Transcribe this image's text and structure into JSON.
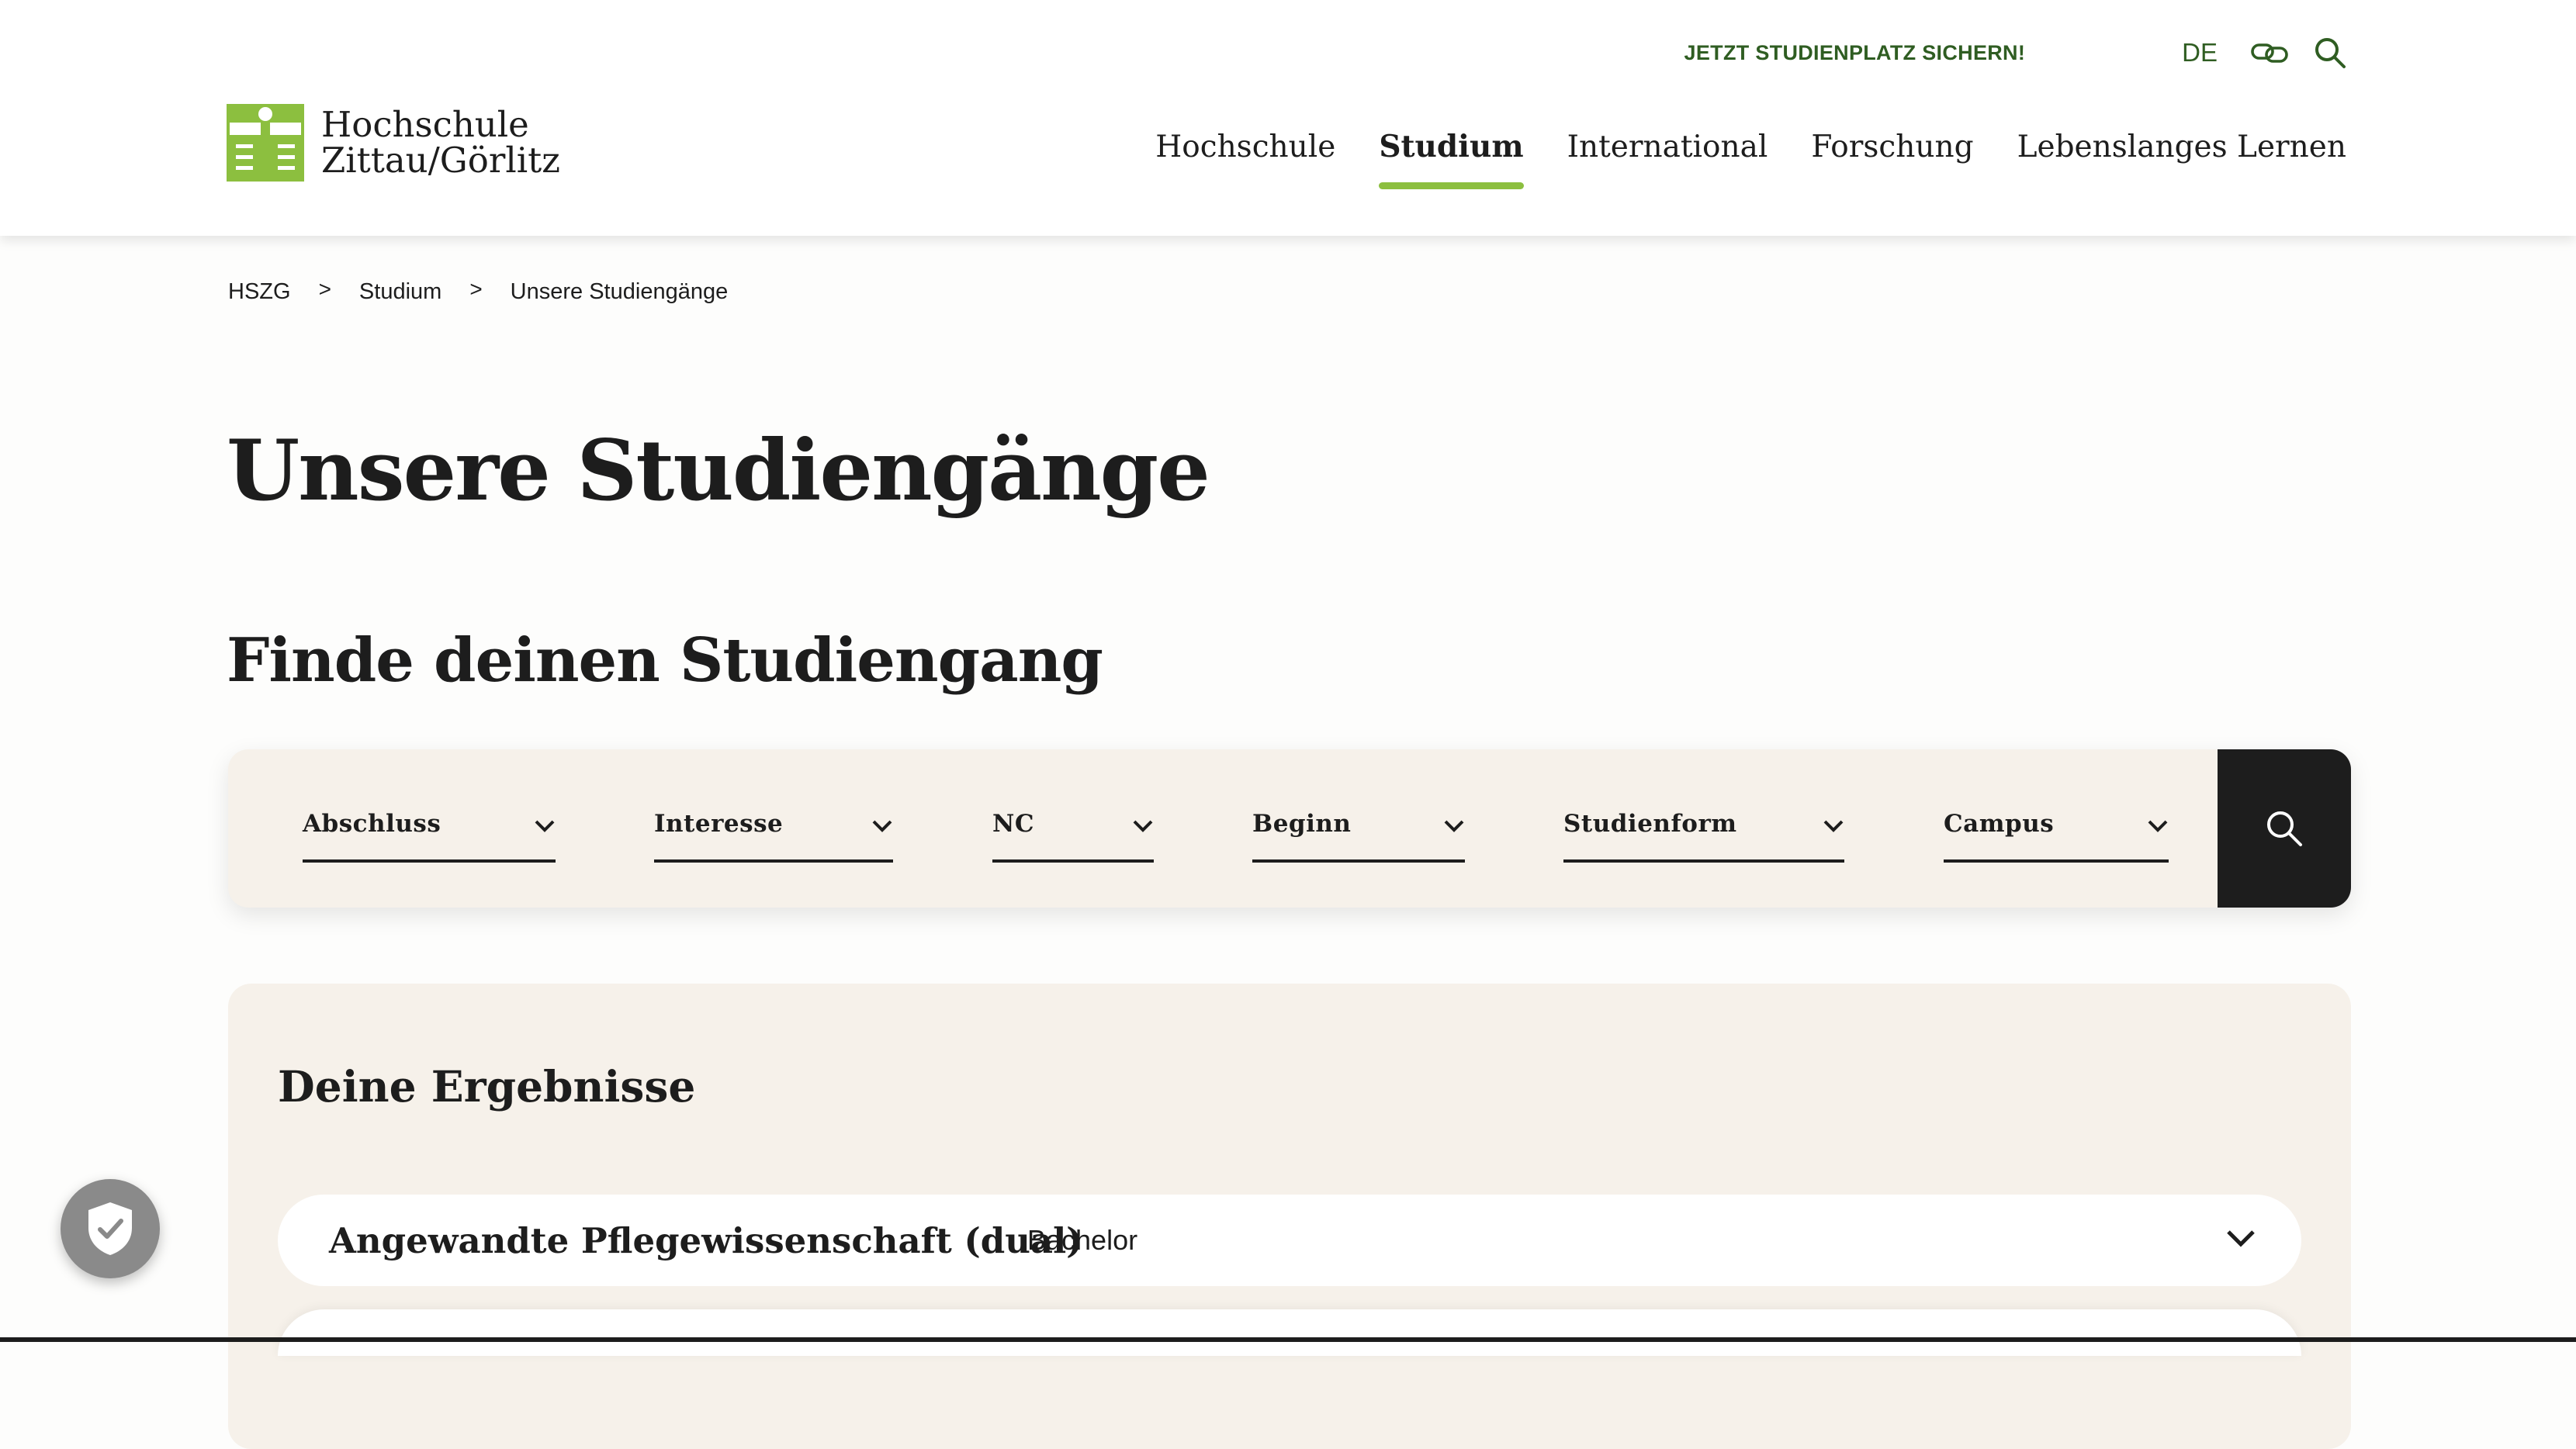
{
  "topbar": {
    "cta": "JETZT STUDIENPLATZ SICHERN!",
    "language": "DE",
    "icons": [
      "links-icon",
      "search-icon"
    ]
  },
  "logo": {
    "line1": "Hochschule",
    "line2": "Zittau/Görlitz",
    "color": "#8cbf3f"
  },
  "nav": {
    "items": [
      {
        "label": "Hochschule",
        "active": false
      },
      {
        "label": "Studium",
        "active": true
      },
      {
        "label": "International",
        "active": false
      },
      {
        "label": "Forschung",
        "active": false
      },
      {
        "label": "Lebenslanges Lernen",
        "active": false
      }
    ]
  },
  "breadcrumb": {
    "items": [
      "HSZG",
      "Studium",
      "Unsere Studiengänge"
    ],
    "separator": ">"
  },
  "page": {
    "title": "Unsere Studiengänge",
    "section_title": "Finde deinen Studiengang"
  },
  "filters": {
    "items": [
      "Abschluss",
      "Interesse",
      "NC",
      "Beginn",
      "Studienform",
      "Campus"
    ],
    "search_icon": "search-icon"
  },
  "results": {
    "title": "Deine Ergebnisse",
    "rows": [
      {
        "name": "Angewandte Pflegewissenschaft (dual)",
        "degree": "Bachelor"
      }
    ]
  },
  "colors": {
    "accent_green": "#8cbf3f",
    "dark_green": "#2f5d22",
    "panel_beige": "#f6f1ea",
    "dark": "#1d1d1d"
  }
}
